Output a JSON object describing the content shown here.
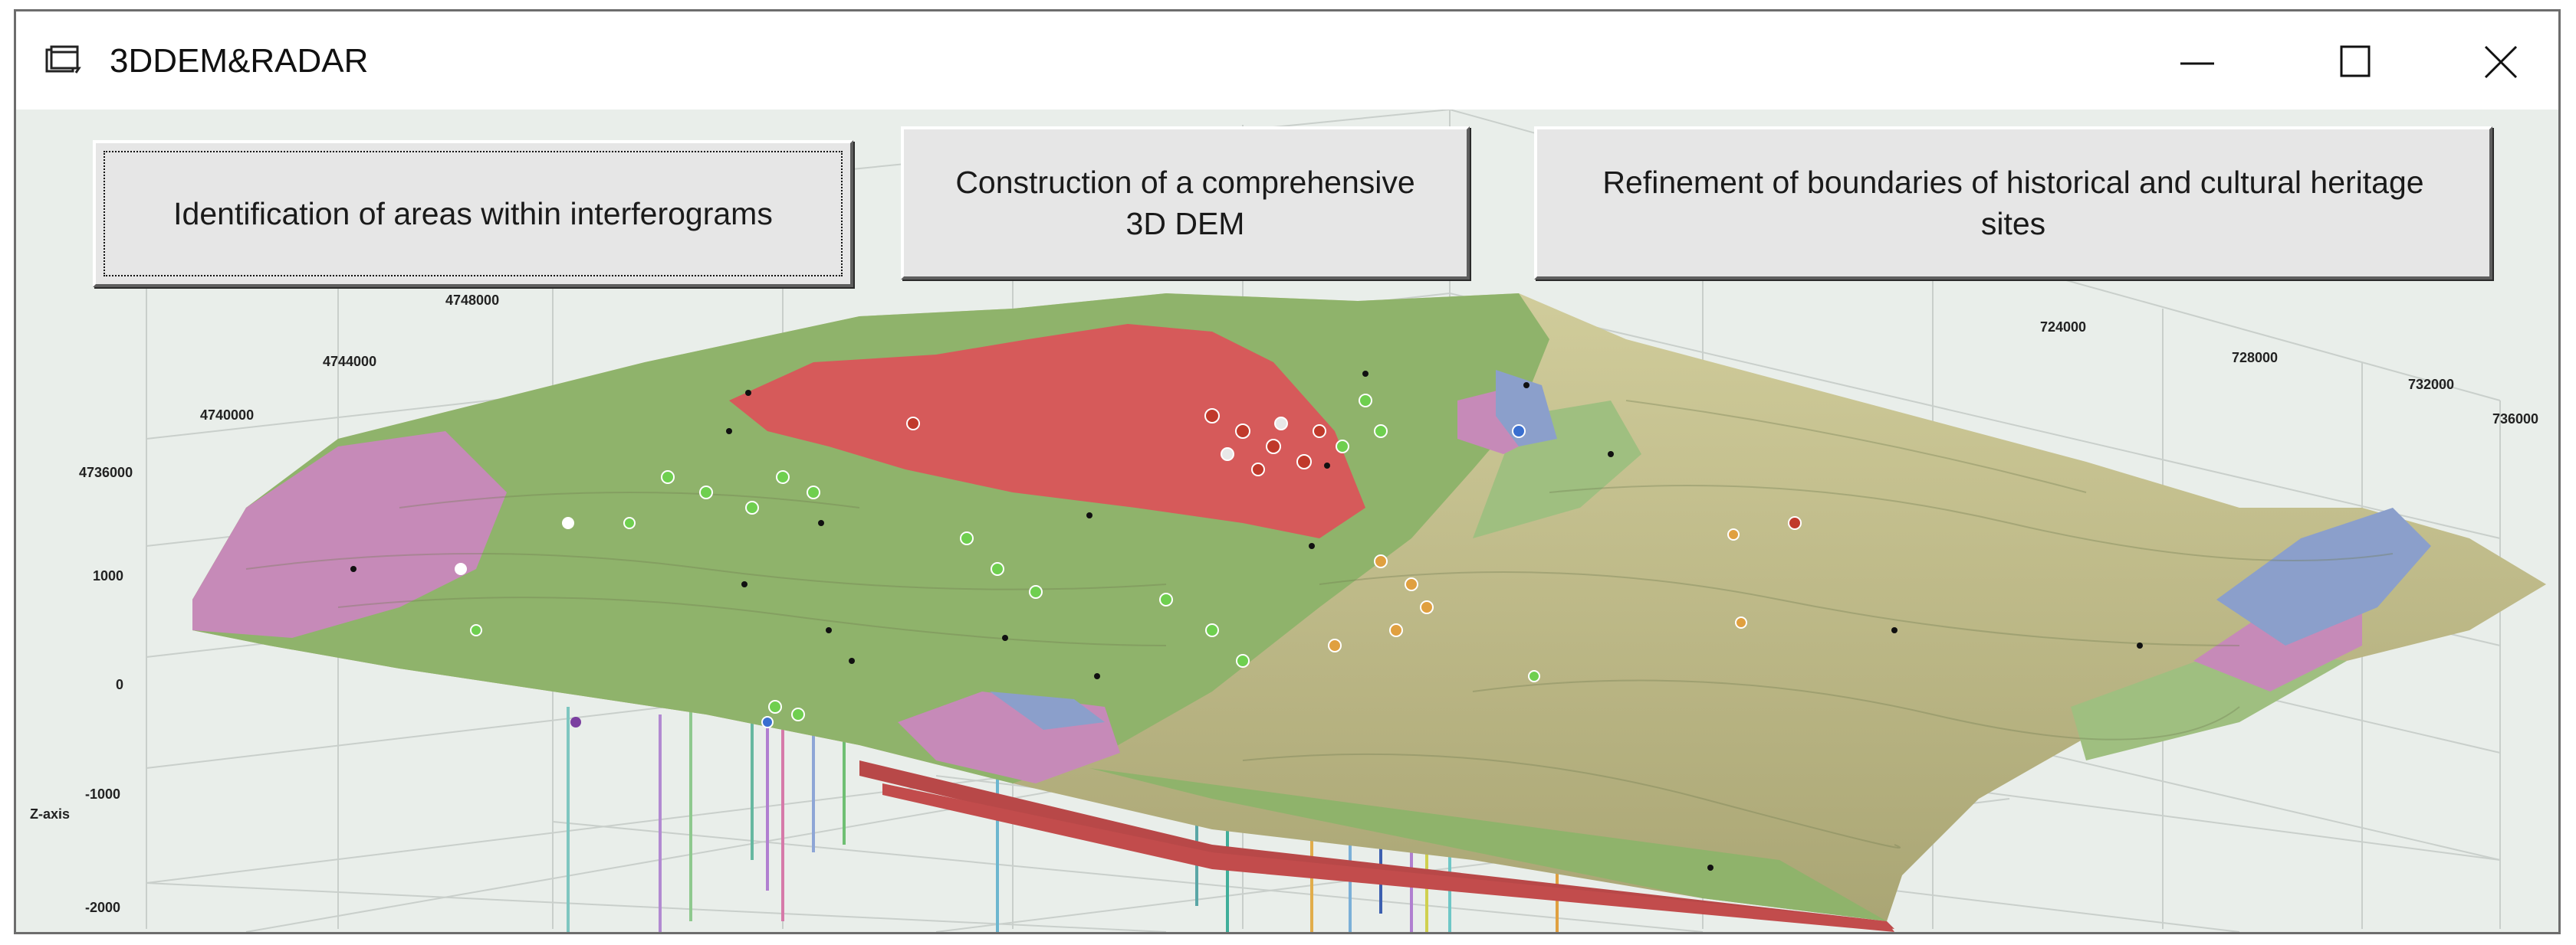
{
  "window": {
    "title": "3DDEM&RADAR",
    "icon": "app-window-icon",
    "controls": {
      "minimize": "minimize-icon",
      "maximize": "maximize-icon",
      "close": "close-icon"
    }
  },
  "buttons": {
    "identification": "Identification of areas within interferograms",
    "construction": "Construction of a comprehensive 3D DEM",
    "refinement": "Refinement of boundaries of historical and cultural heritage sites"
  },
  "plot": {
    "x_ticks": [
      "724000",
      "728000",
      "732000",
      "736000"
    ],
    "y_ticks": [
      "4748000",
      "4744000",
      "4740000",
      "4736000"
    ],
    "z_ticks": [
      "1000",
      "0",
      "-1000",
      "-2000"
    ],
    "z_label": "Z-axis",
    "colors": {
      "background": "#e9eeea",
      "terrain_green": "#8fb36b",
      "terrain_khaki": "#c8c389",
      "volcanic_red": "#d65a5a",
      "heritage_pink": "#c68ab8",
      "water_blue": "#8b9fcb"
    }
  }
}
